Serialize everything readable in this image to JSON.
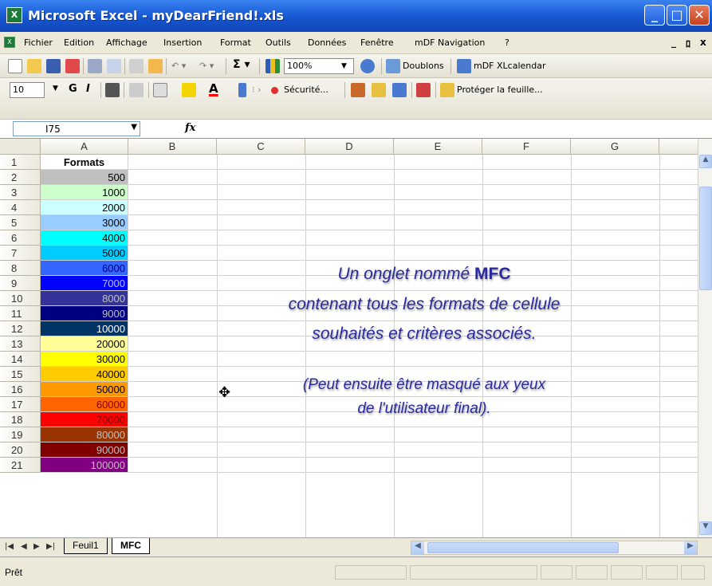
{
  "window": {
    "title": "Microsoft Excel - myDearFriend!.xls",
    "icon_name": "excel-icon"
  },
  "menu": [
    "Fichier",
    "Edition",
    "Affichage",
    "Insertion",
    "Format",
    "Outils",
    "Données",
    "Fenêtre",
    "mDF Navigation",
    "?"
  ],
  "toolbar1": {
    "zoom": "100%",
    "doublons": "Doublons",
    "xlcalendar": "mDF XLcalendar"
  },
  "toolbar2": {
    "font_size": "10",
    "bold": "G",
    "italic": "I",
    "securite": "Sécurité...",
    "proteger": "Protéger la feuille..."
  },
  "formula_bar": {
    "name_box": "I75",
    "fx": "fx",
    "content": ""
  },
  "columns": [
    "A",
    "B",
    "C",
    "D",
    "E",
    "F",
    "G"
  ],
  "sheet": {
    "header": "Formats",
    "rows": [
      {
        "num": "1"
      },
      {
        "num": "2",
        "value": "500",
        "bg": "#c0c0c0",
        "fg": "#000000"
      },
      {
        "num": "3",
        "value": "1000",
        "bg": "#ccffcc",
        "fg": "#000000"
      },
      {
        "num": "4",
        "value": "2000",
        "bg": "#ccffff",
        "fg": "#000000"
      },
      {
        "num": "5",
        "value": "3000",
        "bg": "#99ccff",
        "fg": "#000000"
      },
      {
        "num": "6",
        "value": "4000",
        "bg": "#00ffff",
        "fg": "#000000"
      },
      {
        "num": "7",
        "value": "5000",
        "bg": "#00ccff",
        "fg": "#000000"
      },
      {
        "num": "8",
        "value": "6000",
        "bg": "#3366ff",
        "fg": "#000080"
      },
      {
        "num": "9",
        "value": "7000",
        "bg": "#0000ff",
        "fg": "#c0c0ff"
      },
      {
        "num": "10",
        "value": "8000",
        "bg": "#333399",
        "fg": "#c0c0c0"
      },
      {
        "num": "11",
        "value": "9000",
        "bg": "#000080",
        "fg": "#c0c0c0"
      },
      {
        "num": "12",
        "value": "10000",
        "bg": "#003366",
        "fg": "#ffffff"
      },
      {
        "num": "13",
        "value": "20000",
        "bg": "#ffff99",
        "fg": "#000000"
      },
      {
        "num": "14",
        "value": "30000",
        "bg": "#ffff00",
        "fg": "#000000"
      },
      {
        "num": "15",
        "value": "40000",
        "bg": "#ffcc00",
        "fg": "#000000"
      },
      {
        "num": "16",
        "value": "50000",
        "bg": "#ff9900",
        "fg": "#000000"
      },
      {
        "num": "17",
        "value": "60000",
        "bg": "#ff6600",
        "fg": "#800000"
      },
      {
        "num": "18",
        "value": "70000",
        "bg": "#ff0000",
        "fg": "#800000"
      },
      {
        "num": "19",
        "value": "80000",
        "bg": "#993300",
        "fg": "#c0c0c0"
      },
      {
        "num": "20",
        "value": "90000",
        "bg": "#800000",
        "fg": "#c0c0c0"
      },
      {
        "num": "21",
        "value": "100000",
        "bg": "#800080",
        "fg": "#c0c0c0"
      }
    ]
  },
  "note": {
    "line1_prefix": "Un onglet nommé",
    "line1_bold": "MFC",
    "line2": "contenant tous les formats de cellule",
    "line3": "souhaités et critères associés.",
    "line4": "(Peut ensuite être masqué aux yeux",
    "line5": "de l'utilisateur final)."
  },
  "tabs": [
    "Feuil1",
    "MFC"
  ],
  "active_tab": "MFC",
  "status": "Prêt"
}
